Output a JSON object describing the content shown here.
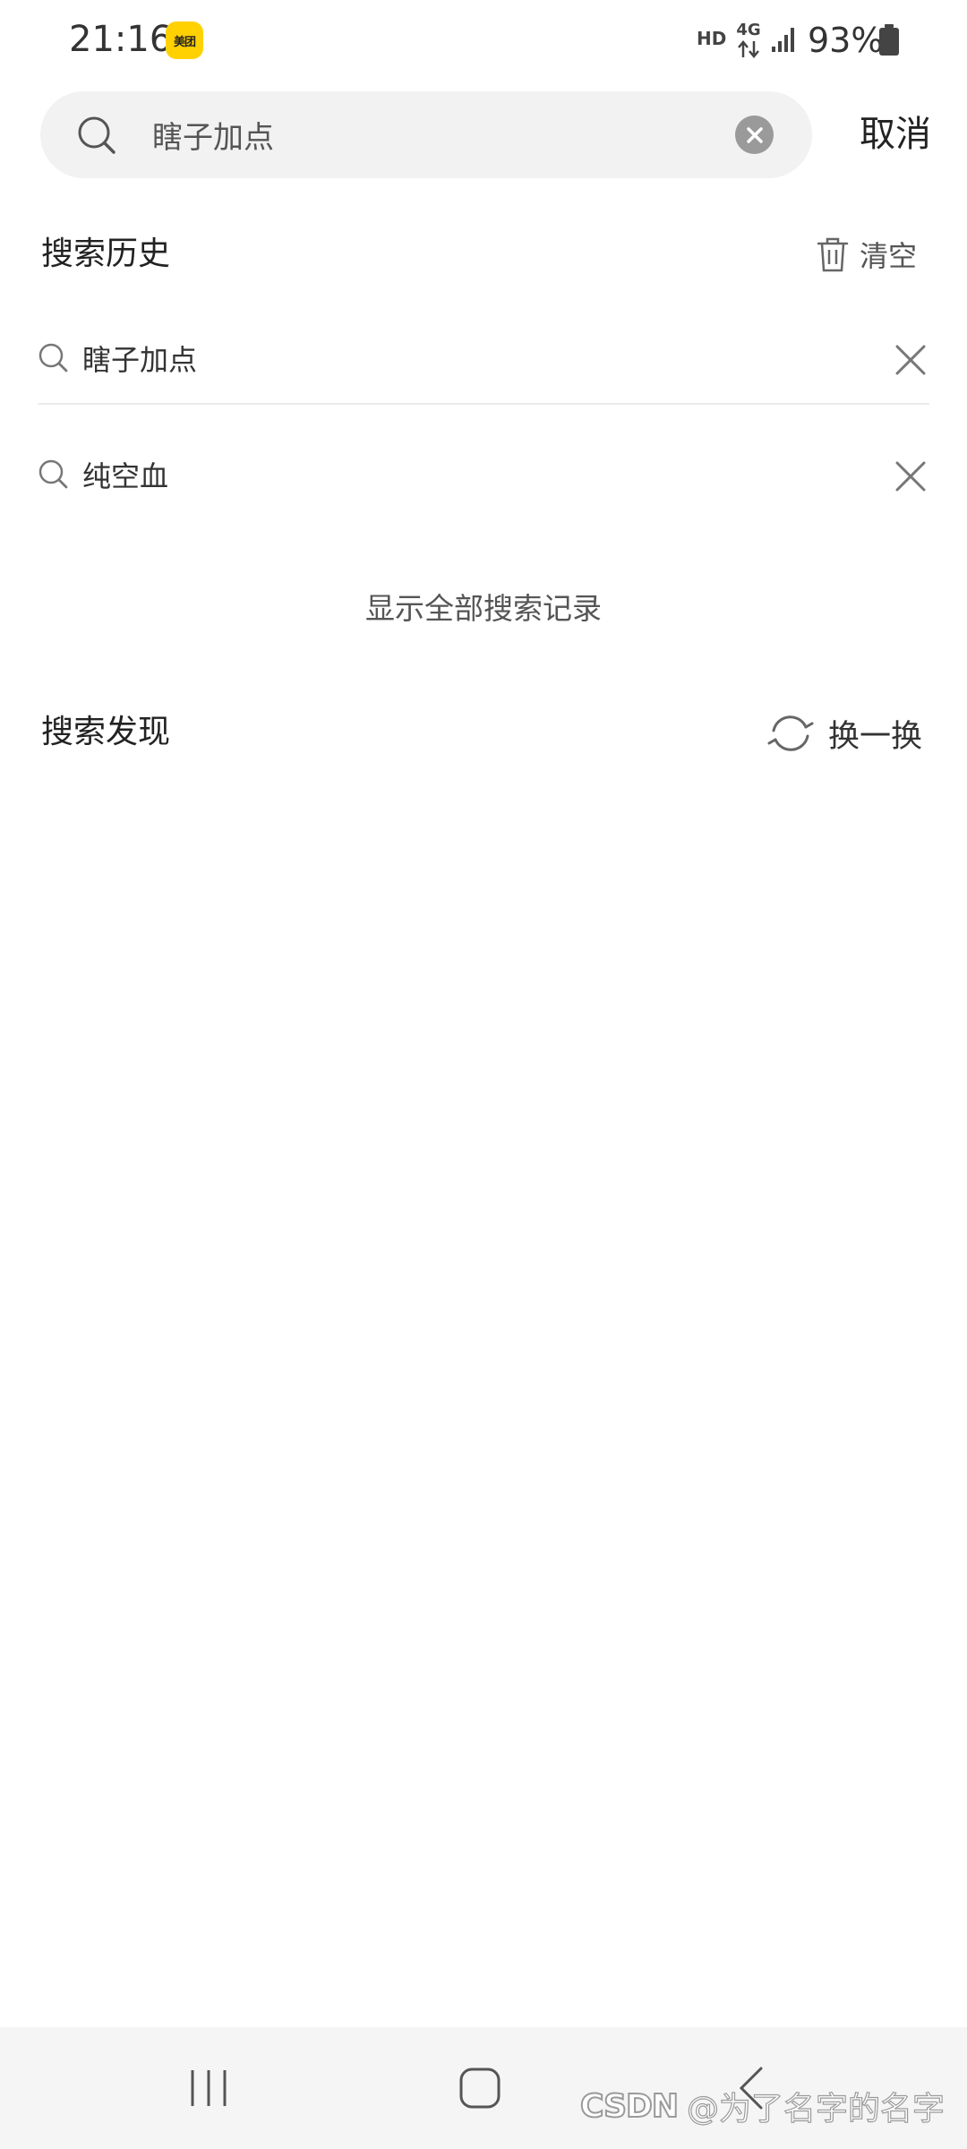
{
  "status_bar": {
    "time": "21:16",
    "app_badge": "美团",
    "hd": "HD",
    "network": "4G",
    "battery": "93%"
  },
  "search": {
    "query": "瞎子加点",
    "cancel_label": "取消"
  },
  "history": {
    "title": "搜索历史",
    "clear_label": "清空",
    "items": [
      {
        "text": "瞎子加点"
      },
      {
        "text": "纯空血"
      }
    ],
    "show_all_label": "显示全部搜索记录"
  },
  "discover": {
    "title": "搜索发现",
    "refresh_label": "换一换"
  },
  "watermark": {
    "logo": "CSDN",
    "text": "@为了名字的名字"
  },
  "colors": {
    "badge": "#ffd100",
    "search_bg": "#f2f2f2",
    "icon_gray": "#9a9a9a"
  }
}
